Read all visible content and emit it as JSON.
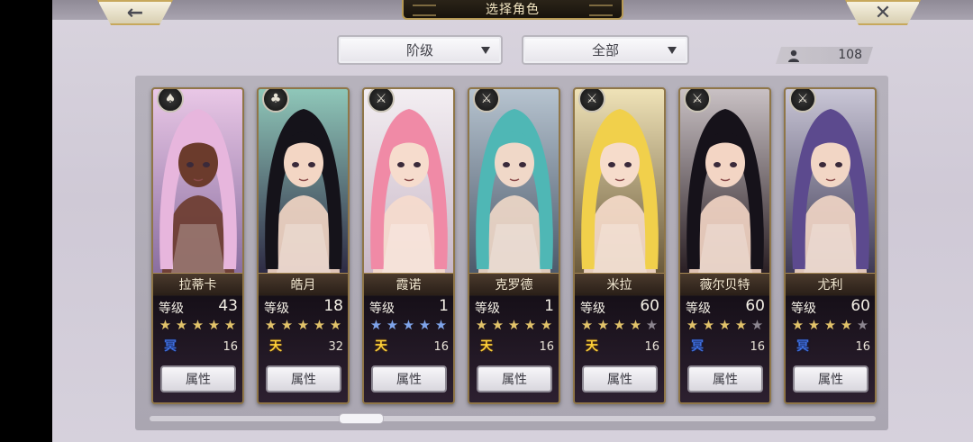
{
  "header": {
    "title": "选择角色",
    "back_icon": "←",
    "close_icon": "✕"
  },
  "filters": {
    "rank_label": "阶级",
    "type_label": "全部"
  },
  "roster_count": "108",
  "characters": [
    {
      "name": "拉蒂卡",
      "level_label": "等级",
      "level": "43",
      "stars": 5,
      "star_color": "gold",
      "tier": "冥",
      "tier_style": "ming",
      "count": "16",
      "attr_label": "属性"
    },
    {
      "name": "皓月",
      "level_label": "等级",
      "level": "18",
      "stars": 5,
      "star_color": "gold",
      "tier": "天",
      "tier_style": "sky",
      "count": "32",
      "attr_label": "属性"
    },
    {
      "name": "霞诺",
      "level_label": "等级",
      "level": "1",
      "stars": 5,
      "star_color": "blue",
      "tier": "天",
      "tier_style": "sky",
      "count": "16",
      "attr_label": "属性"
    },
    {
      "name": "克罗德",
      "level_label": "等级",
      "level": "1",
      "stars": 5,
      "star_color": "gold",
      "tier": "天",
      "tier_style": "sky",
      "count": "16",
      "attr_label": "属性"
    },
    {
      "name": "米拉",
      "level_label": "等级",
      "level": "60",
      "stars": 4,
      "star_color": "gold",
      "tier": "天",
      "tier_style": "sky",
      "count": "16",
      "attr_label": "属性"
    },
    {
      "name": "薇尔贝特",
      "level_label": "等级",
      "level": "60",
      "stars": 4,
      "star_color": "gold",
      "tier": "冥",
      "tier_style": "ming",
      "count": "16",
      "attr_label": "属性"
    },
    {
      "name": "尤利",
      "level_label": "等级",
      "level": "60",
      "stars": 4,
      "star_color": "gold",
      "tier": "冥",
      "tier_style": "ming",
      "count": "16",
      "attr_label": "属性"
    }
  ],
  "colors": {
    "frame_gold": "#8f7648",
    "star_gold": "#e2c36a",
    "star_blue": "#7fa4ea",
    "tier_sky": "#ffd23a",
    "tier_ming": "#3e6ddc"
  }
}
